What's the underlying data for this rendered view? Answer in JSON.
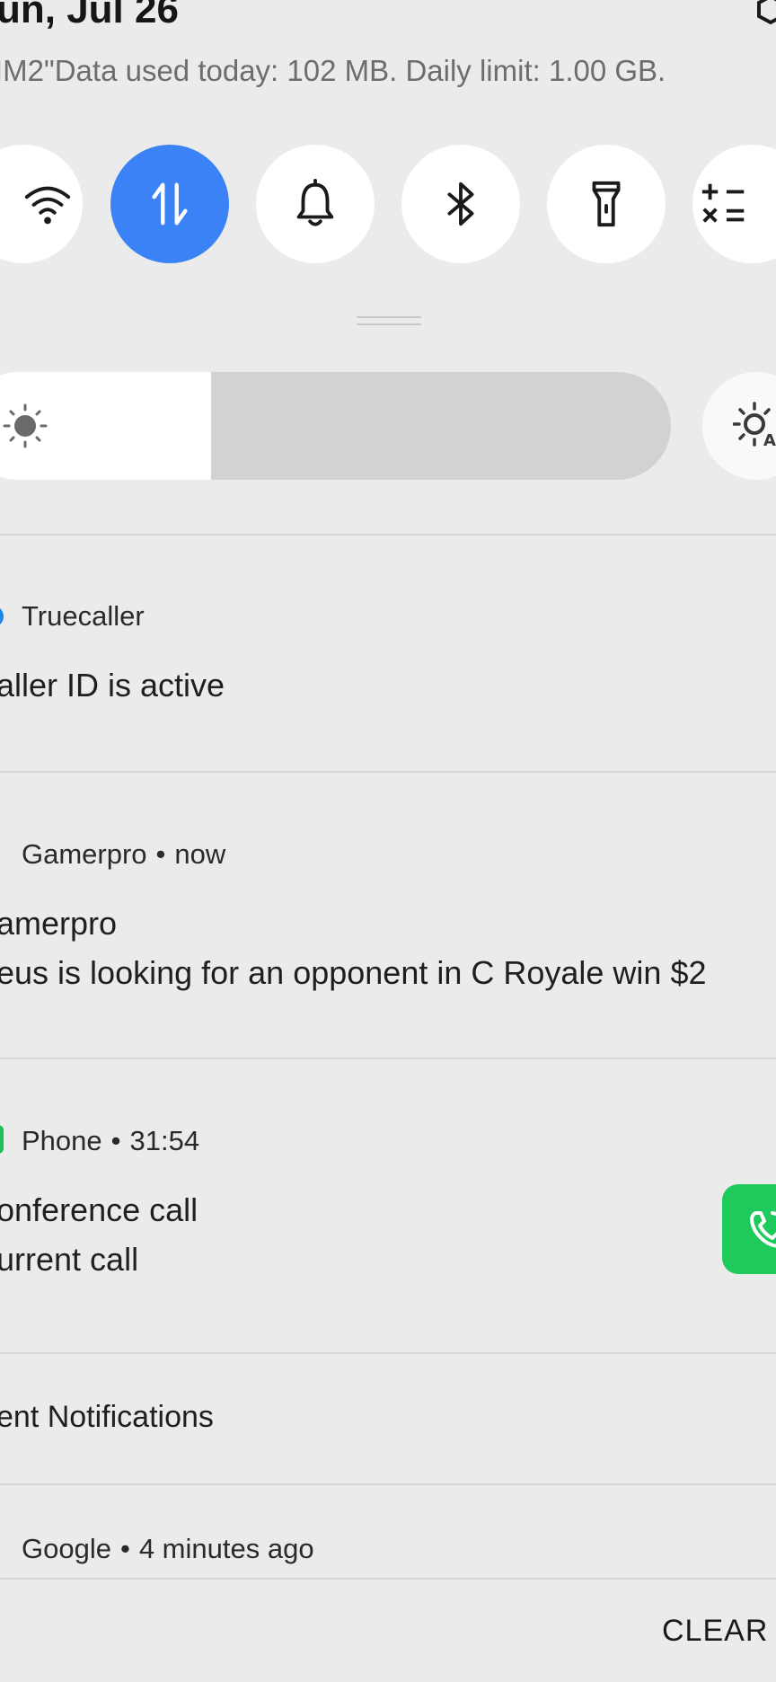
{
  "header": {
    "date": "un, Jul 26",
    "data_usage": "IM2\"Data used today: 102 MB. Daily limit: 1.00 GB."
  },
  "quick_tiles": [
    {
      "name": "wifi",
      "icon": "wifi-icon",
      "active": false
    },
    {
      "name": "mobile-data",
      "icon": "data-arrows-icon",
      "active": true
    },
    {
      "name": "sound",
      "icon": "bell-icon",
      "active": false
    },
    {
      "name": "bluetooth",
      "icon": "bluetooth-icon",
      "active": false
    },
    {
      "name": "flashlight",
      "icon": "flashlight-icon",
      "active": false
    },
    {
      "name": "calculator",
      "icon": "calculator-icon",
      "active": false
    }
  ],
  "brightness": {
    "level": 0.35,
    "icon": "sun-icon",
    "auto_icon": "auto-brightness-icon"
  },
  "notifications": [
    {
      "app": "Truecaller",
      "time": "",
      "title": "aller ID is active",
      "text": ""
    },
    {
      "app": "Gamerpro",
      "time": "now",
      "title": "amerpro",
      "text": "eus is looking for an opponent in C Royale win $2"
    },
    {
      "app": "Phone",
      "time": "31:54",
      "title": "onference call",
      "text": "urrent call"
    }
  ],
  "silent_section": {
    "title": "ent Notifications"
  },
  "google_row": {
    "app": "Google",
    "time": "4 minutes ago"
  },
  "footer": {
    "clear_label": "CLEAR A"
  },
  "colors": {
    "background": "#ebebeb",
    "accent": "#3b82f6",
    "call_green": "#1fca5c",
    "truecaller_blue": "#1a87e6"
  }
}
